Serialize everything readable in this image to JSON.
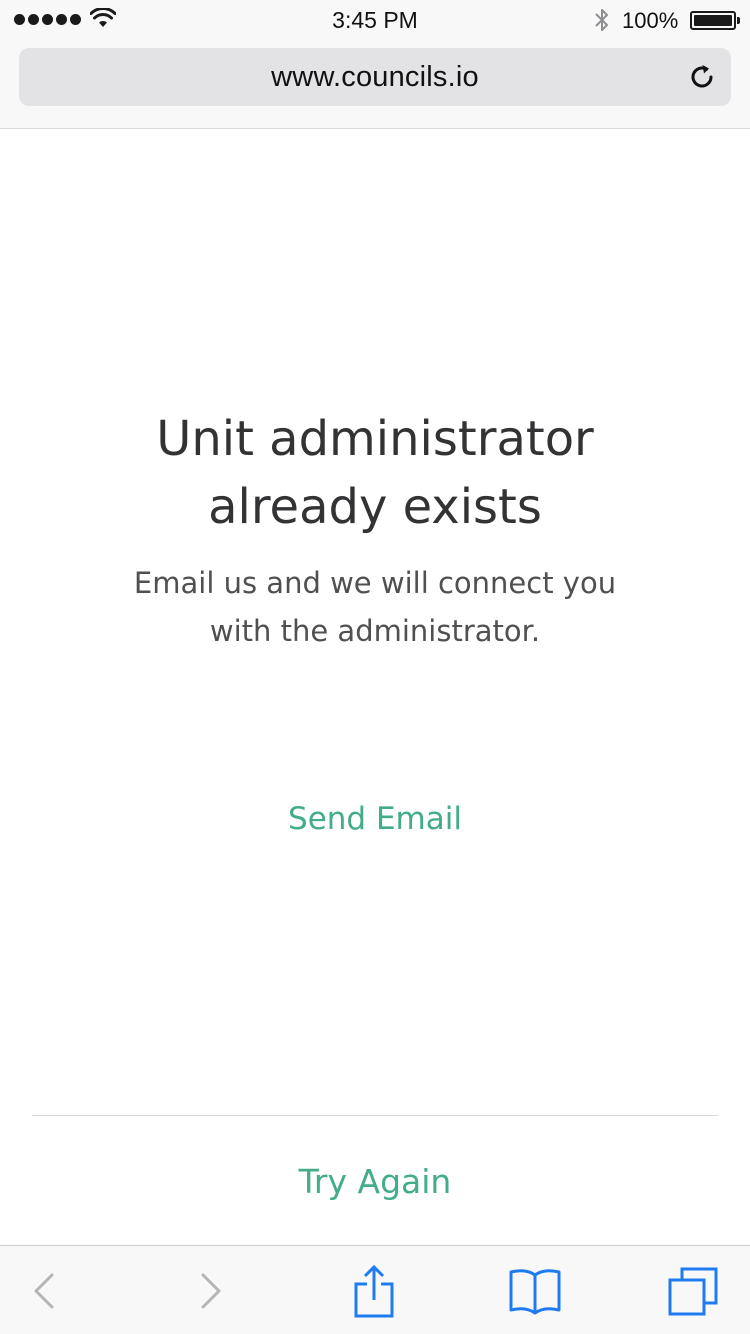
{
  "status_bar": {
    "time": "3:45 PM",
    "battery_percent": "100%",
    "signal_bars": 5,
    "battery_level": 1.0,
    "icons": [
      "signal-dots-icon",
      "wifi-icon",
      "bluetooth-icon",
      "battery-icon"
    ]
  },
  "browser": {
    "url": "www.councils.io",
    "reload_icon": "reload-icon",
    "toolbar_icons": [
      "back-icon",
      "forward-icon",
      "share-icon",
      "bookmarks-icon",
      "tabs-icon"
    ]
  },
  "content": {
    "headline_line1": "Unit administrator",
    "headline_line2": "already exists",
    "subtitle_line1": "Email us and we will connect you",
    "subtitle_line2": "with the administrator.",
    "send_email_label": "Send Email",
    "try_again_label": "Try Again"
  },
  "colors": {
    "accent": "#43ac8a",
    "ios_blue": "#1f7cf0",
    "disabled": "#b5b5b5",
    "text_dark": "#333336"
  }
}
